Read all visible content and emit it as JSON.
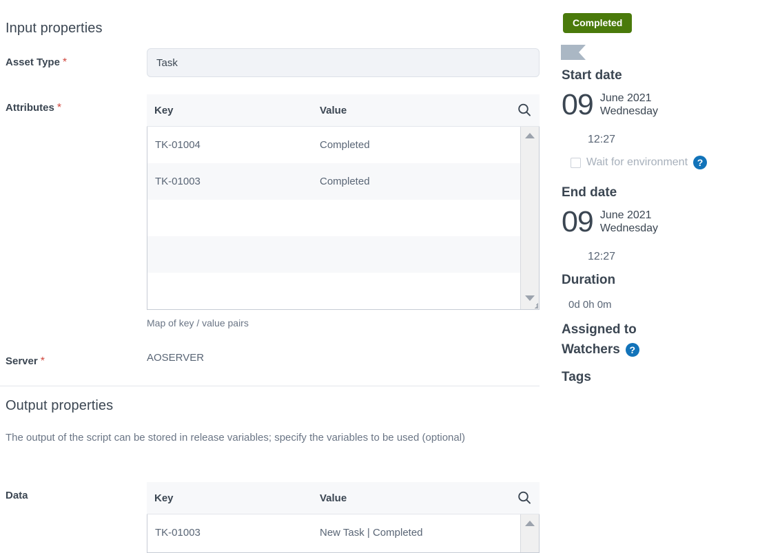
{
  "input_section": {
    "title": "Input properties",
    "asset_type": {
      "label": "Asset Type",
      "required_marker": "*",
      "value": "Task",
      "placeholder": ""
    },
    "attributes": {
      "label": "Attributes",
      "required_marker": "*",
      "helper": "Map of key / value pairs",
      "columns": {
        "key": "Key",
        "value": "Value"
      },
      "search_icon": "search-icon",
      "rows": [
        {
          "key": "TK-01004",
          "value": "Completed"
        },
        {
          "key": "TK-01003",
          "value": "Completed"
        },
        {
          "key": "",
          "value": ""
        },
        {
          "key": "",
          "value": ""
        },
        {
          "key": "",
          "value": ""
        }
      ]
    },
    "server": {
      "label": "Server",
      "required_marker": "*",
      "value": "AOSERVER"
    }
  },
  "output_section": {
    "title": "Output properties",
    "description": "The output of the script can be stored in release variables; specify the variables to be used (optional)",
    "data": {
      "label": "Data",
      "columns": {
        "key": "Key",
        "value": "Value"
      },
      "search_icon": "search-icon",
      "rows": [
        {
          "key": "TK-01003",
          "value": "New Task | Completed"
        }
      ]
    }
  },
  "sidebar": {
    "status_badge": {
      "label": "Completed",
      "color": "#4a7a0b"
    },
    "flag_icon": {
      "name": "flag-icon",
      "color": "#aab7c4"
    },
    "start_date": {
      "heading": "Start date",
      "day": "09",
      "month_year": "June 2021",
      "weekday": "Wednesday",
      "time": "12:27"
    },
    "wait_for_environment": {
      "label": "Wait for environment",
      "checked": false,
      "help_icon": "?"
    },
    "end_date": {
      "heading": "End date",
      "day": "09",
      "month_year": "June 2021",
      "weekday": "Wednesday",
      "time": "12:27"
    },
    "duration": {
      "heading": "Duration",
      "value": "0d 0h 0m"
    },
    "assigned_to": {
      "heading": "Assigned to"
    },
    "watchers": {
      "heading": "Watchers",
      "help_icon": "?"
    },
    "tags": {
      "heading": "Tags"
    }
  }
}
